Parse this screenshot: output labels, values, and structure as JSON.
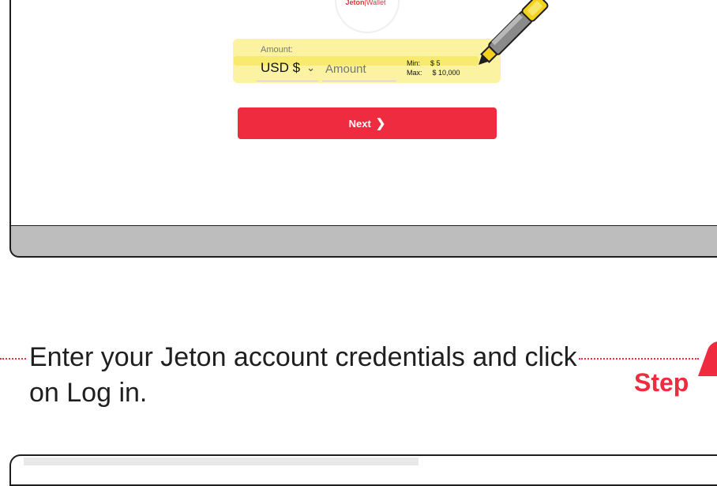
{
  "screen1": {
    "logo": {
      "brand": "Jeton",
      "separator": "|",
      "product": "Wallet"
    },
    "form": {
      "amount_label": "Amount:",
      "currency_value": "USD $",
      "currency_chevron_icon": "chevron-down-icon",
      "amount_placeholder": "Amount",
      "min_label": "Min:",
      "min_value": "$ 5",
      "max_label": "Max:",
      "max_value": "$ 10,000"
    },
    "next_button": {
      "label": "Next",
      "icon": "chevron-right-icon"
    },
    "marker_icon": "highlighter-marker-icon"
  },
  "step": {
    "instruction": "Enter your Jeton account credentials and click on Log in.",
    "label": "Step"
  },
  "colors": {
    "accent": "#ef2b3f",
    "highlight": "#fbf3a2",
    "highlight_stroke": "#f6e65a",
    "laptop_base": "#bdbdbd"
  }
}
